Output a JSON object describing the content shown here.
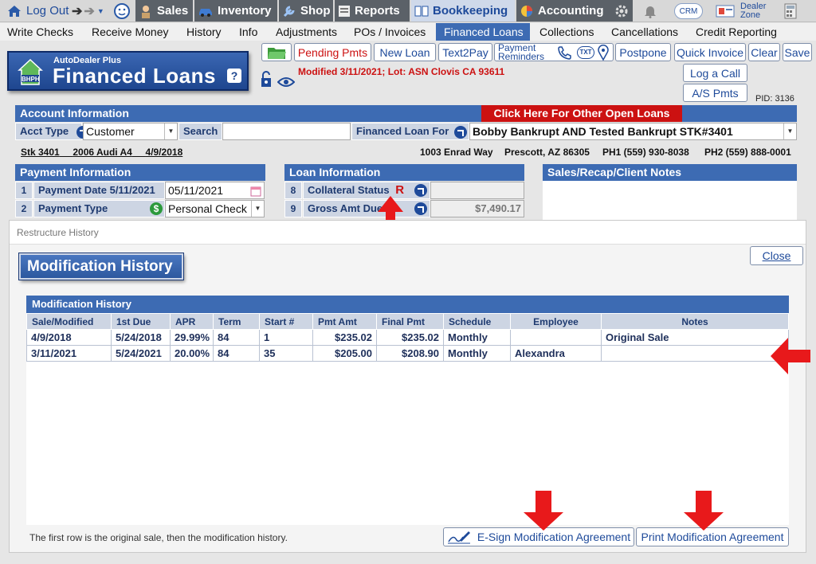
{
  "colors": {
    "nav_blue": "#3d6bb3",
    "accent_red": "#cc1111",
    "label_bg": "#cdd5e3"
  },
  "topnav": {
    "logout": "Log Out",
    "sales": "Sales",
    "inventory": "Inventory",
    "shop": "Shop",
    "reports": "Reports",
    "bookkeeping": "Bookkeeping",
    "accounting": "Accounting",
    "crm": "CRM",
    "dealer_zone_1": "Dealer",
    "dealer_zone_2": "Zone"
  },
  "subnav": [
    "Write Checks",
    "Receive Money",
    "History",
    "Info",
    "Adjustments",
    "POs / Invoices",
    "Financed Loans",
    "Collections",
    "Cancellations",
    "Credit Reporting"
  ],
  "logo": {
    "small": "AutoDealer Plus",
    "big": "Financed Loans",
    "badge": "BHPH",
    "help": "?"
  },
  "toolbar": {
    "pending": "Pending Pmts",
    "new_loan": "New Loan",
    "text2pay": "Text2Pay",
    "reminders_1": "Payment",
    "reminders_2": "Reminders",
    "txt": "TXT",
    "postpone": "Postpone",
    "quick_invoice": "Quick Invoice",
    "clear": "Clear",
    "save": "Save",
    "log_call": "Log a Call",
    "as_pmts": "A/S Pmts"
  },
  "modified_info": "Modified 3/11/2021; Lot: ASN Clovis CA 93611",
  "pid": "PID: 3136",
  "account": {
    "header": "Account Information",
    "other_loans": "Click Here For Other Open Loans",
    "acct_type_label": "Acct Type",
    "acct_type_value": "Customer",
    "search_label": "Search",
    "search_value": "",
    "financed_for_label": "Financed Loan For",
    "financed_for_value": "Bobby Bankrupt AND Tested Bankrupt STK#3401",
    "stk": "Stk 3401",
    "vehicle": "2006 Audi A4",
    "date": "4/9/2018",
    "address": "1003 Enrad Way",
    "city": "Prescott, AZ 86305",
    "ph1": "PH1 (559) 930-8038",
    "ph2": "PH2 (559) 888-0001"
  },
  "payment": {
    "header": "Payment Information",
    "row1_num": "1",
    "row1_label": "Payment Date  5/11/2021",
    "row1_value": "05/11/2021",
    "row2_num": "2",
    "row2_label": "Payment Type",
    "row2_value": "Personal Check"
  },
  "loan": {
    "header": "Loan Information",
    "row8_num": "8",
    "row8_label": "Collateral Status",
    "row8_code": "R",
    "row9_num": "9",
    "row9_label": "Gross Amt Due",
    "row9_value": "$7,490.17"
  },
  "notes_header": "Sales/Recap/Client Notes",
  "modal": {
    "window_title": "Restructure History",
    "badge": "Modification History",
    "close": "Close",
    "grid_title": "Modification History",
    "columns": [
      "Sale/Modified",
      "1st Due",
      "APR",
      "Term",
      "Start #",
      "Pmt Amt",
      "Final Pmt",
      "Schedule",
      "Employee",
      "Notes"
    ],
    "rows": [
      [
        "4/9/2018",
        "5/24/2018",
        "29.99%",
        "84",
        "1",
        "$235.02",
        "$235.02",
        "Monthly",
        "",
        "Original Sale"
      ],
      [
        "3/11/2021",
        "5/24/2021",
        "20.00%",
        "84",
        "35",
        "$205.00",
        "$208.90",
        "Monthly",
        "Alexandra",
        ""
      ]
    ],
    "footnote": "The first row is the original sale, then the modification history.",
    "esign": "E-Sign Modification Agreement",
    "print": "Print Modification Agreement"
  }
}
